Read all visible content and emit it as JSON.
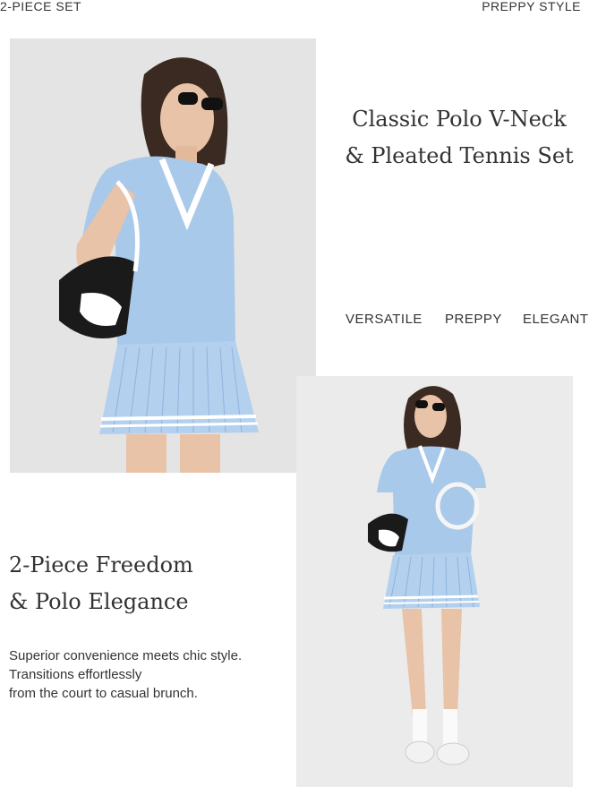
{
  "header": {
    "left": "2-PIECE SET",
    "right": "PREPPY STYLE"
  },
  "hero": {
    "title_line1": "Classic Polo V-Neck",
    "title_line2": "& Pleated Tennis Set"
  },
  "tags": [
    "VERSATILE",
    "PREPPY",
    "ELEGANT"
  ],
  "feature": {
    "title_line1": "2-Piece Freedom",
    "title_line2": "& Polo Elegance",
    "body_line1": "Superior convenience meets chic style.",
    "body_line2": "Transitions effortlessly",
    "body_line3": "from the court to casual brunch."
  },
  "colors": {
    "outfit_blue": "#a9c9ea",
    "stripe": "#ffffff",
    "text": "#333333"
  }
}
